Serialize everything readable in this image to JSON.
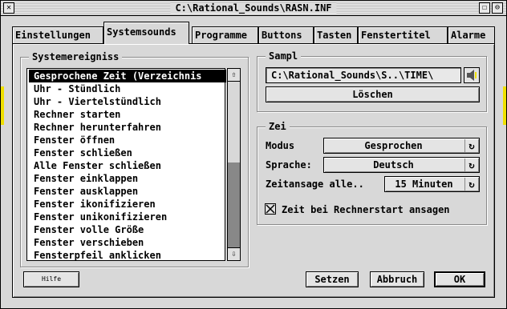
{
  "window": {
    "title": "C:\\Rational_Sounds\\RASN.INF",
    "title_buttons": [
      "☐",
      "⊖"
    ]
  },
  "tabs": [
    {
      "label": "Einstellungen",
      "active": false
    },
    {
      "label": "Systemsounds",
      "active": true
    },
    {
      "label": "Programme",
      "active": false
    },
    {
      "label": "Buttons",
      "active": false
    },
    {
      "label": "Tasten",
      "active": false
    },
    {
      "label": "Fenstertitel",
      "active": false
    },
    {
      "label": "Alarme",
      "active": false
    }
  ],
  "systemereigniss": {
    "title": "Systemereigniss",
    "items": [
      "Gesprochene Zeit (Verzeichnis",
      "Uhr - Stündlich",
      "Uhr - Viertelstündlich",
      "Rechner starten",
      "Rechner herunterfahren",
      "Fenster öffnen",
      "Fenster schließen",
      "Alle Fenster schließen",
      "Fenster einklappen",
      "Fenster ausklappen",
      "Fenster ikonifizieren",
      "Fenster unikonifizieren",
      "Fenster volle Größe",
      "Fenster verschieben",
      "Fensterpfeil anklicken"
    ],
    "selected_index": 0,
    "scroll_up_icon": "⇧",
    "scroll_down_icon": "⇩"
  },
  "sampl": {
    "title": "Sampl",
    "path": "C:\\Rational_Sounds\\S..\\TIME\\",
    "delete_label": "Löschen"
  },
  "zeit": {
    "title": "Zei",
    "modus_label": "Modus",
    "modus_value": "Gesprochen",
    "sprache_label": "Sprache:",
    "sprache_value": "Deutsch",
    "zeitansage_label": "Zeitansage alle..",
    "zeitansage_value": "15 Minuten",
    "checkbox_label": "Zeit bei Rechnerstart ansagen",
    "checkbox_checked": true,
    "cycle_icon": "↻"
  },
  "footer": {
    "help_label": "Hilfe",
    "setzen_label": "Setzen",
    "abbruch_label": "Abbruch",
    "ok_label": "OK"
  }
}
